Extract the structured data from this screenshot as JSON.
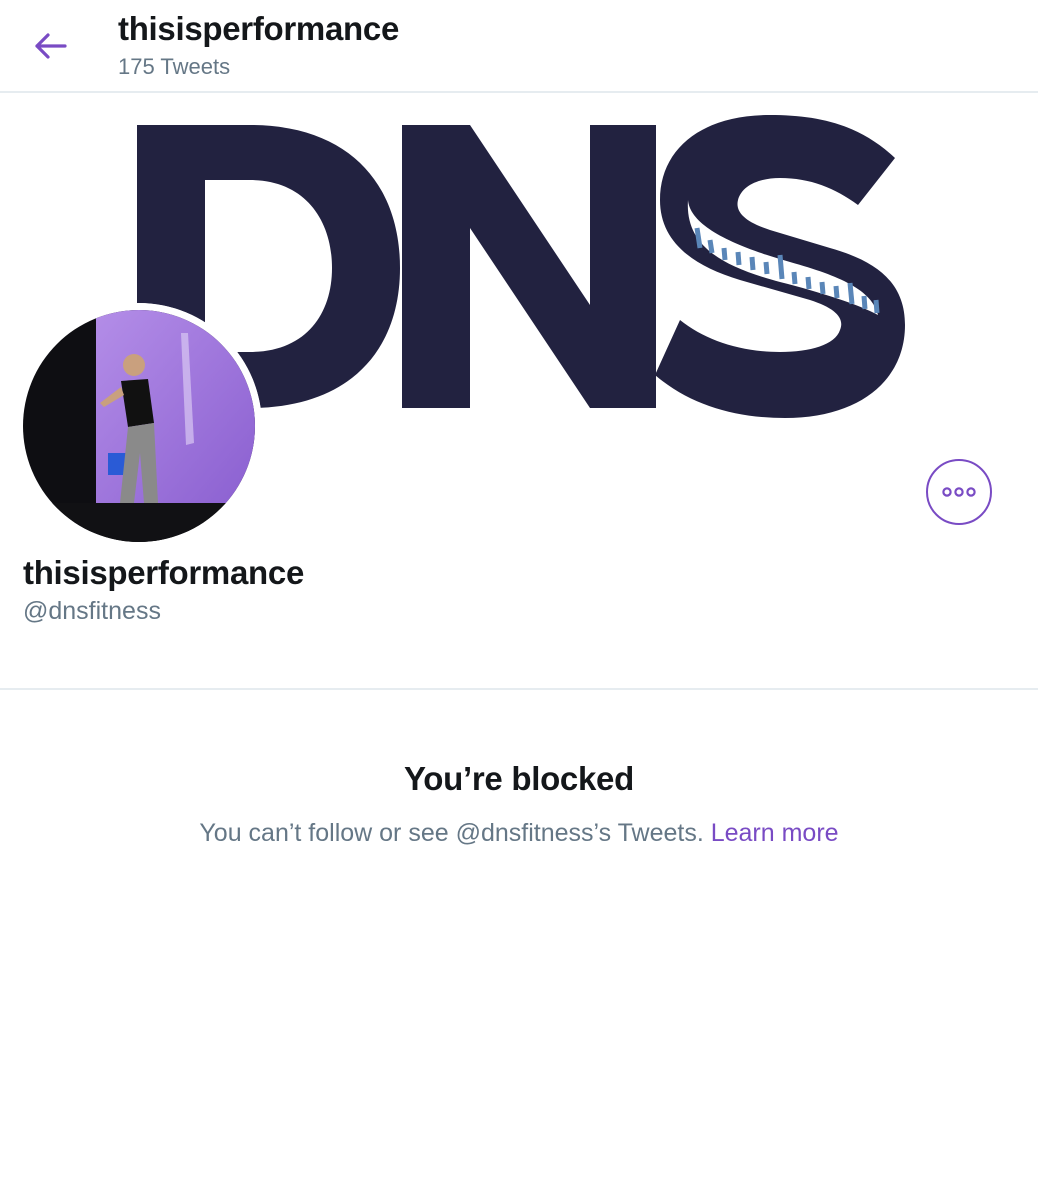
{
  "header": {
    "title": "thisisperformance",
    "tweet_count": "175 Tweets"
  },
  "banner": {
    "logo_text": "DNS"
  },
  "profile": {
    "display_name": "thisisperformance",
    "handle": "@dnsfitness"
  },
  "blocked": {
    "title": "You’re blocked",
    "description": "You can’t follow or see @dnsfitness’s Tweets.",
    "learn_more": "Learn more"
  },
  "colors": {
    "accent": "#794bc4",
    "text_primary": "#14171a",
    "text_secondary": "#657786",
    "border": "#e6ecf0",
    "logo_navy": "#222240",
    "logo_blue": "#5a86b8"
  },
  "icons": {
    "back": "back-arrow-icon",
    "more": "more-horizontal-icon"
  }
}
